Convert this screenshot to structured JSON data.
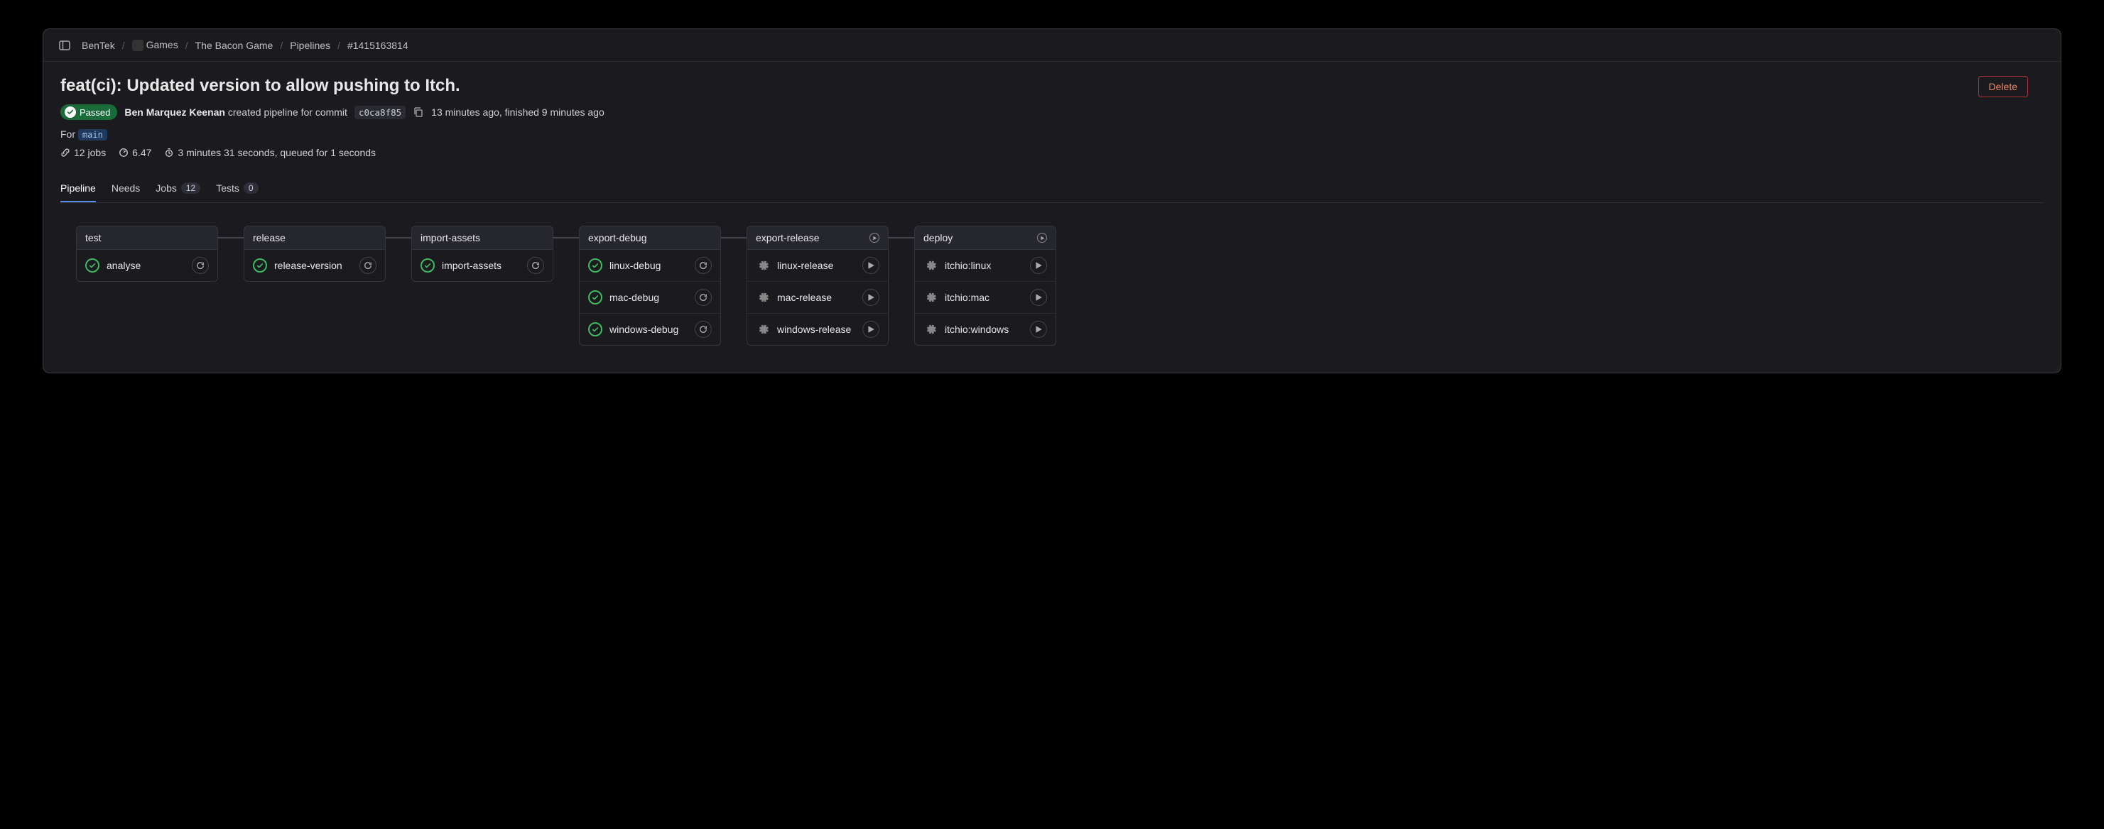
{
  "breadcrumb": {
    "items": [
      "BenTek",
      "Games",
      "The Bacon Game",
      "Pipelines",
      "#1415163814"
    ]
  },
  "header": {
    "title": "feat(ci): Updated version to allow pushing to Itch.",
    "status_label": "Passed",
    "author": "Ben Marquez Keenan",
    "created_text": "created pipeline for commit",
    "commit_sha": "c0ca8f85",
    "time_text": "13 minutes ago, finished 9 minutes ago",
    "delete_label": "Delete",
    "for_label": "For",
    "branch": "main",
    "jobs_count": "12 jobs",
    "score": "6.47",
    "duration_text": "3 minutes 31 seconds, queued for 1 seconds"
  },
  "tabs": [
    {
      "label": "Pipeline",
      "count": null,
      "active": true
    },
    {
      "label": "Needs",
      "count": null,
      "active": false
    },
    {
      "label": "Jobs",
      "count": "12",
      "active": false
    },
    {
      "label": "Tests",
      "count": "0",
      "active": false
    }
  ],
  "stages": [
    {
      "name": "test",
      "has_play": false,
      "jobs": [
        {
          "name": "analyse",
          "status": "passed",
          "action": "retry"
        }
      ]
    },
    {
      "name": "release",
      "has_play": false,
      "jobs": [
        {
          "name": "release-version",
          "status": "passed",
          "action": "retry"
        }
      ]
    },
    {
      "name": "import-assets",
      "has_play": false,
      "jobs": [
        {
          "name": "import-assets",
          "status": "passed",
          "action": "retry"
        }
      ]
    },
    {
      "name": "export-debug",
      "has_play": false,
      "jobs": [
        {
          "name": "linux-debug",
          "status": "passed",
          "action": "retry"
        },
        {
          "name": "mac-debug",
          "status": "passed",
          "action": "retry"
        },
        {
          "name": "windows-debug",
          "status": "passed",
          "action": "retry"
        }
      ]
    },
    {
      "name": "export-release",
      "has_play": true,
      "jobs": [
        {
          "name": "linux-release",
          "status": "manual",
          "action": "play"
        },
        {
          "name": "mac-release",
          "status": "manual",
          "action": "play"
        },
        {
          "name": "windows-release",
          "status": "manual",
          "action": "play"
        }
      ]
    },
    {
      "name": "deploy",
      "has_play": true,
      "jobs": [
        {
          "name": "itchio:linux",
          "status": "manual",
          "action": "play"
        },
        {
          "name": "itchio:mac",
          "status": "manual",
          "action": "play"
        },
        {
          "name": "itchio:windows",
          "status": "manual",
          "action": "play"
        }
      ]
    }
  ]
}
